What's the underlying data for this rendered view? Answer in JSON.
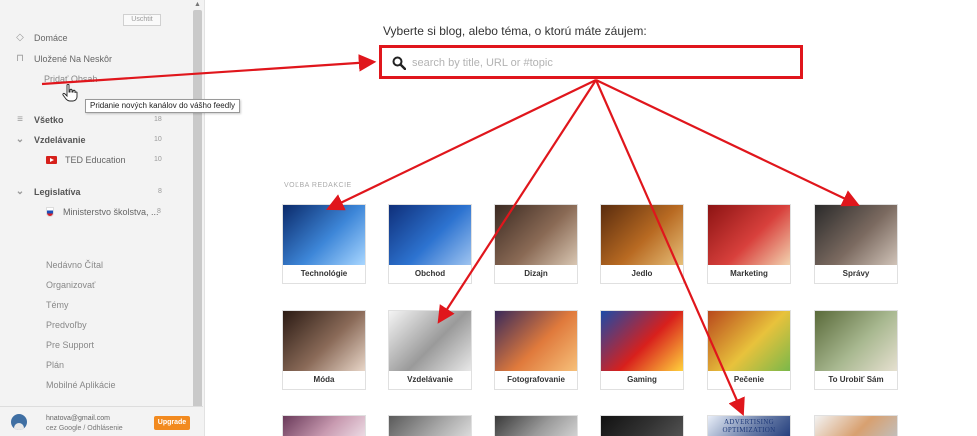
{
  "sidebar": {
    "pin_label": "Uschtit",
    "nav": [
      {
        "label": "Domáce",
        "icon": "home-icon"
      },
      {
        "label": "Uložené Na Neskôr",
        "icon": "bookmark-icon"
      },
      {
        "label": "Pridať Obsah",
        "icon": ""
      }
    ],
    "feeds": [
      {
        "label": "Všetko",
        "count": "18"
      },
      {
        "label": "Vzdelávanie",
        "count": "10"
      },
      {
        "label": "TED Education",
        "count": "10"
      },
      {
        "label": "Legislatíva",
        "count": "8"
      },
      {
        "label": "Ministerstvo školstva, ...",
        "count": "8"
      }
    ],
    "lower": [
      "Nedávno Čítal",
      "Organizovať",
      "Témy",
      "Predvoľby",
      "Pre Support",
      "Plán",
      "Mobilné Aplikácie"
    ],
    "account": {
      "email": "hnatova@gmail.com",
      "via": "cez Google / Odhlásenie",
      "upgrade_label": "Upgrade"
    }
  },
  "tooltip": "Pridanie nových kanálov do vášho feedly",
  "main": {
    "prompt": "Vyberte si blog, alebo téma, o ktorú máte záujem:",
    "search_placeholder": "search by title, URL or #topic",
    "section_label": "VOĽBA REDAKCIE",
    "tiles": [
      {
        "label": "Technológie",
        "colors": [
          "#0b2a6a",
          "#3d86d8",
          "#a8d6ff"
        ]
      },
      {
        "label": "Obchod",
        "colors": [
          "#0f2f7a",
          "#2d73d0",
          "#9fc4f0"
        ]
      },
      {
        "label": "Dizajn",
        "colors": [
          "#3b2a22",
          "#8a6a55",
          "#d8c6b2"
        ]
      },
      {
        "label": "Jedlo",
        "colors": [
          "#5a2c0e",
          "#b86a22",
          "#e7c07a"
        ]
      },
      {
        "label": "Marketing",
        "colors": [
          "#8c1313",
          "#d8403c",
          "#f2d3b0"
        ]
      },
      {
        "label": "Správy",
        "colors": [
          "#2a2a2a",
          "#7b6a60",
          "#d0c3b8"
        ]
      },
      {
        "label": "Móda",
        "colors": [
          "#2b1b14",
          "#8a6a58",
          "#e8d6c8"
        ]
      },
      {
        "label": "Vzdelávanie",
        "colors": [
          "#f4f4f4",
          "#9a9a9a",
          "#e8e8e8"
        ]
      },
      {
        "label": "Fotografovanie",
        "colors": [
          "#3a2a5a",
          "#e07a3c",
          "#f6c07a"
        ]
      },
      {
        "label": "Gaming",
        "colors": [
          "#1b4aa8",
          "#d8201c",
          "#ffd23c"
        ]
      },
      {
        "label": "Pečenie",
        "colors": [
          "#b8481c",
          "#e8c23c",
          "#7ab84a"
        ]
      },
      {
        "label": "To Urobiť Sám",
        "colors": [
          "#5a6a3a",
          "#a8b890",
          "#e6e0d0"
        ]
      },
      {
        "label": "",
        "colors": [
          "#6a3a5a",
          "#c89ab0",
          "#efe0e8"
        ]
      },
      {
        "label": "",
        "colors": [
          "#5a5a5a",
          "#a6a6a6",
          "#e0e0e0"
        ]
      },
      {
        "label": "",
        "colors": [
          "#3a3a3a",
          "#9a9a9a",
          "#d6d6d6"
        ]
      },
      {
        "label": "",
        "colors": [
          "#111111",
          "#333333",
          "#555555"
        ]
      },
      {
        "label": "",
        "colors": [
          "#e8eef8",
          "#6a7ea8",
          "#1f3a7a"
        ],
        "caption": "ADVERTISING OPTIMIZATION"
      },
      {
        "label": "",
        "colors": [
          "#f2f2f2",
          "#d8a070",
          "#c0c0c0"
        ]
      }
    ]
  },
  "annotation_color": "#e0161c"
}
